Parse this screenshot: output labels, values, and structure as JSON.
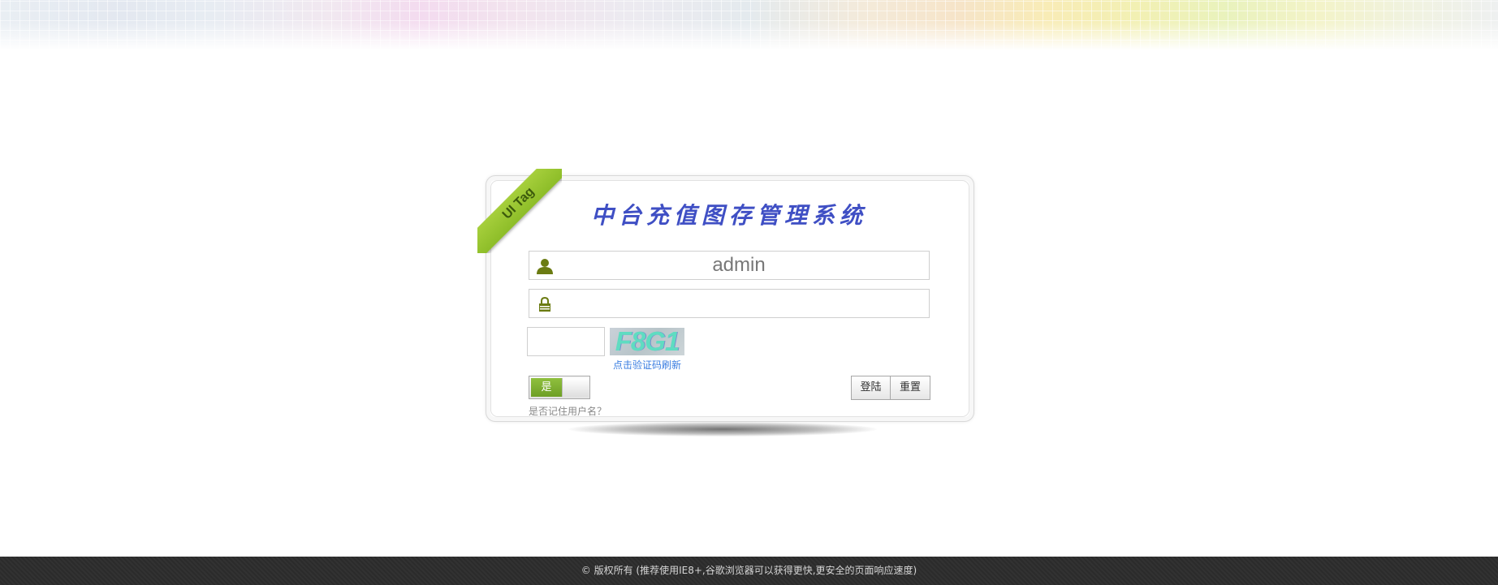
{
  "header": {
    "title": "中台充值图存管理系统",
    "ribbon_label": "UI Tag"
  },
  "login_form": {
    "username_value": "admin",
    "password_value": "",
    "captcha_input_value": "",
    "captcha_text": "F8G1",
    "captcha_refresh_label": "点击验证码刷新",
    "remember_toggle_label": "是",
    "remember_toggle_state": "on",
    "remember_label": "是否记住用户名？",
    "login_button_label": "登陆",
    "reset_button_label": "重置"
  },
  "icons": {
    "username": "user-icon",
    "password": "lock-icon"
  },
  "colors": {
    "title": "#3f4fc4",
    "ribbon": "#9ac534",
    "icon": "#6b7b12",
    "toggle_on": "#7fb232",
    "footer_bg": "#2b2b2b"
  },
  "footer": {
    "text": "© 版权所有 (推荐使用IE8+,谷歌浏览器可以获得更快,更安全的页面响应速度)"
  }
}
